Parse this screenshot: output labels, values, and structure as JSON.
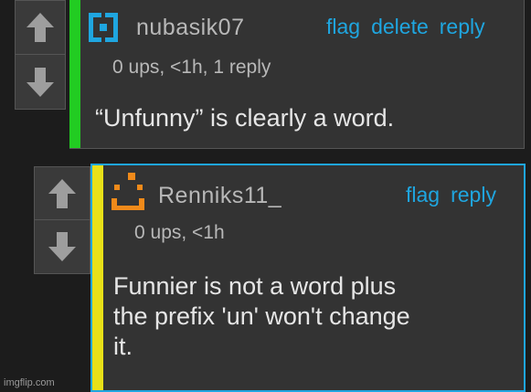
{
  "comments": [
    {
      "username": "nubasik07",
      "meta": "0 ups, <1h, 1 reply",
      "actions": [
        "flag",
        "delete",
        "reply"
      ],
      "text": "“Unfunny” is clearly a word.",
      "bar_color": "#22cc22",
      "avatar_icon": "square-face-avatar-icon",
      "avatar_color": "#1fa6e0"
    },
    {
      "username": "Renniks11_",
      "meta": "0 ups, <1h",
      "actions": [
        "flag",
        "reply"
      ],
      "text_lines": [
        "Funnier is not a word plus",
        "the prefix 'un' won't change",
        "it."
      ],
      "bar_color": "#e8e018",
      "border_color": "#1fa6e0",
      "avatar_icon": "smiley-face-avatar-icon",
      "avatar_color": "#f08a1a"
    }
  ],
  "watermark": "imgflip.com",
  "colors": {
    "background": "#1c1c1c",
    "panel": "#333333",
    "link": "#1fa6e0",
    "text": "#e6e6e6",
    "meta": "#b8b8b8"
  }
}
